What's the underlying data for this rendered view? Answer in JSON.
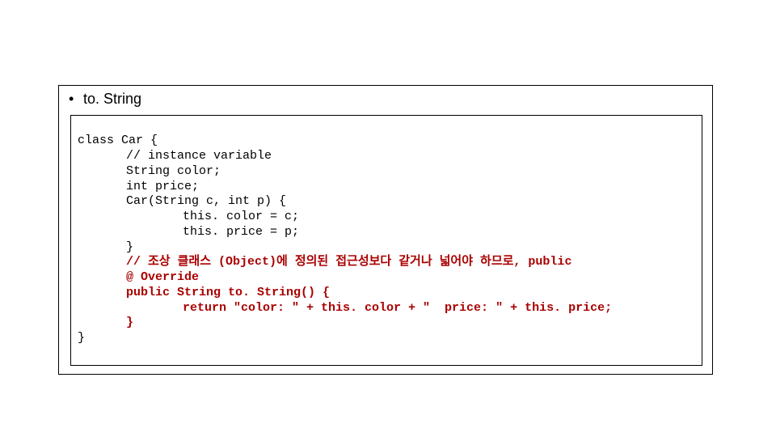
{
  "heading": {
    "bullet": "•",
    "text": "to. String"
  },
  "code": {
    "l01": "class Car {",
    "l02_comment": "// instance variable",
    "l03": "String color;",
    "l04": "int price;",
    "l05": "Car(String c, int p) {",
    "l06": "this. color = c;",
    "l07": "this. price = p;",
    "l08": "}",
    "l09_r": "// 조상 클래스 (Object)에 정의된 접근성보다 같거나 넓어야 하므로, public",
    "l10_r": "@ Override",
    "l11_r": "public String to. String() {",
    "l12_r": "return \"color: \" + this. color + \"  price: \" + this. price;",
    "l13_r": "}",
    "l14": "}"
  }
}
